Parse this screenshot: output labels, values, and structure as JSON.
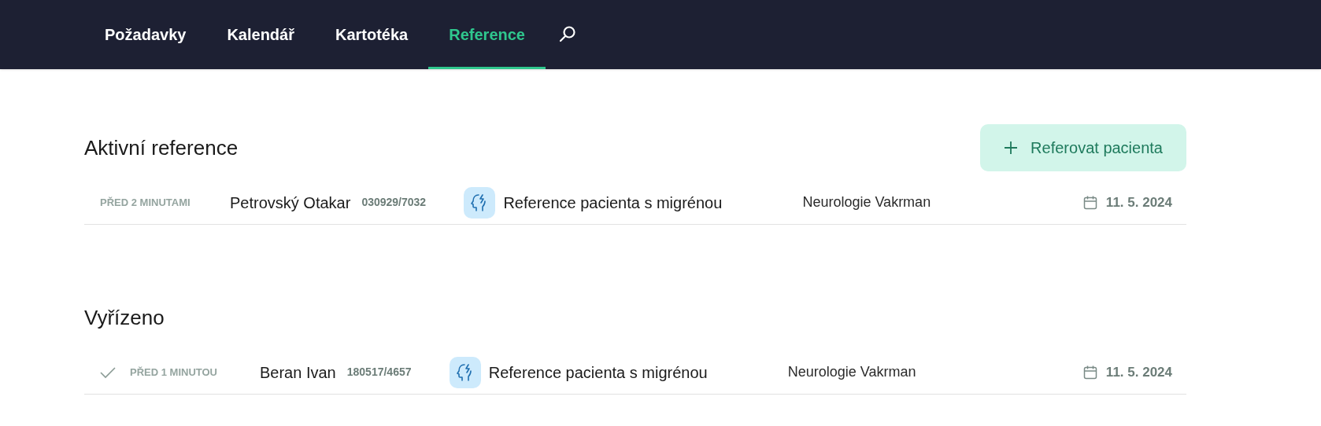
{
  "nav": {
    "tabs": [
      {
        "label": "Požadavky",
        "selected": false
      },
      {
        "label": "Kalendář",
        "selected": false
      },
      {
        "label": "Kartotéka",
        "selected": false
      },
      {
        "label": "Reference",
        "selected": true
      }
    ]
  },
  "sections": [
    {
      "title": "Aktivní reference",
      "button": "Referovat pacienta",
      "rows": [
        {
          "done": false,
          "time": "PŘED 2 MINUTAMI",
          "name": "Petrovský Otakar",
          "id": "030929/7032",
          "subject": "Reference pacienta s migrénou",
          "department": "Neurologie Vakrman",
          "date": "11. 5. 2024"
        }
      ]
    },
    {
      "title": "Vyřízeno",
      "rows": [
        {
          "done": true,
          "time": "PŘED 1 MINUTOU",
          "name": "Beran Ivan",
          "id": "180517/4657",
          "subject": "Reference pacienta s migrénou",
          "department": "Neurologie Vakrman",
          "date": "11. 5. 2024"
        }
      ]
    }
  ]
}
